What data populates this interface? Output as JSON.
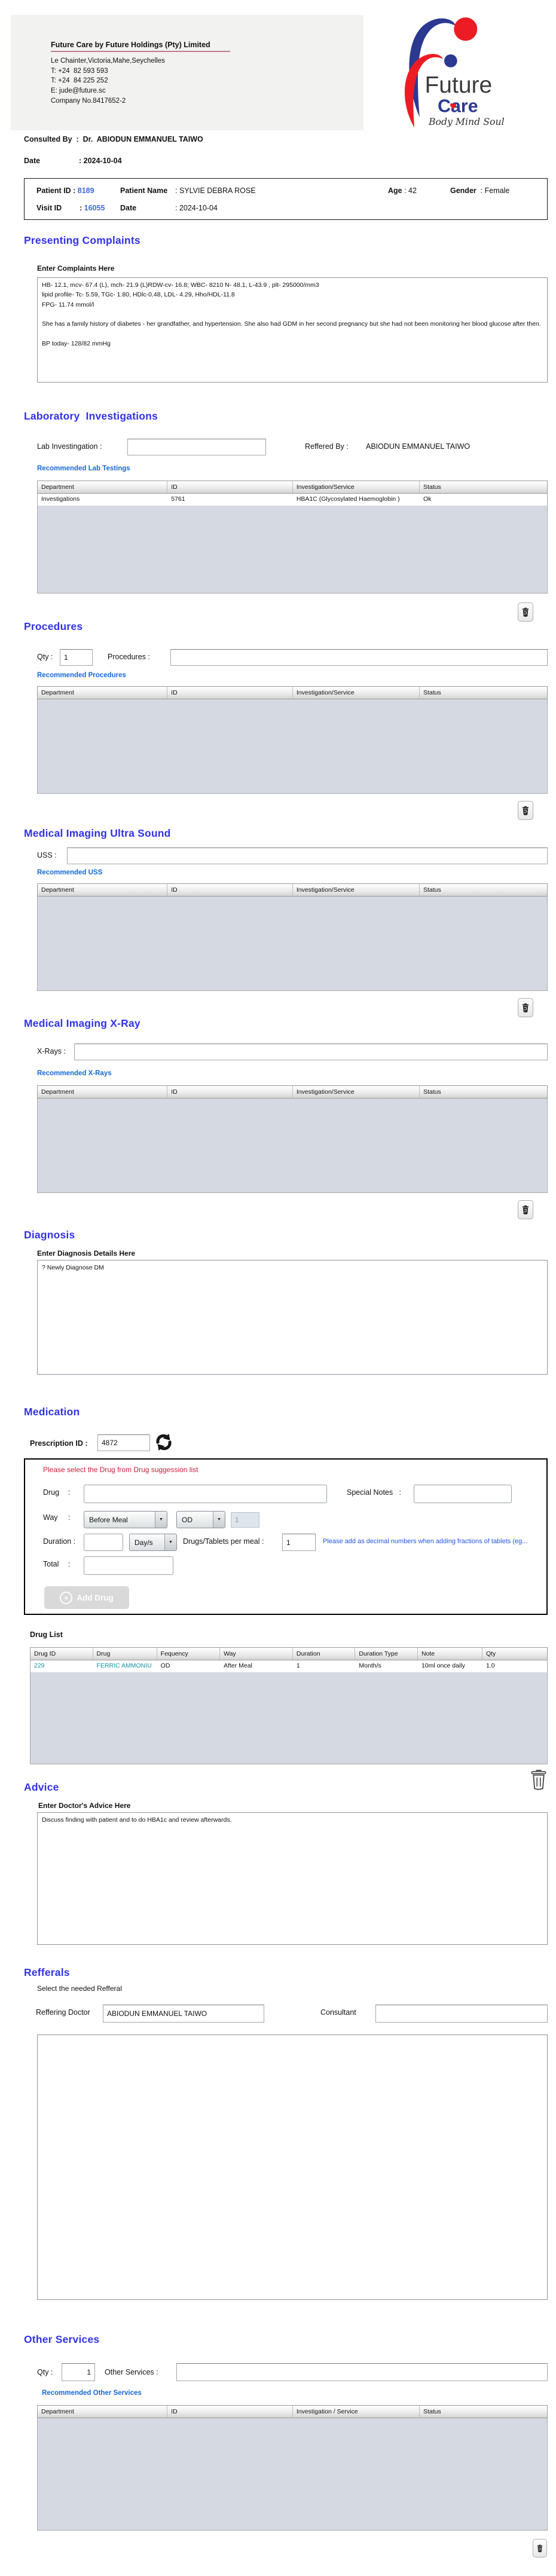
{
  "colors": {
    "heading_blue": "#3232ec",
    "link_blue": "#1569d8",
    "alert_red": "#c81e3c",
    "note_blue": "#2255e8",
    "value_blue": "#4169e1",
    "teal": "#1696a6",
    "logo_blue": "#2b3990",
    "logo_red": "#ed1c24"
  },
  "header": {
    "company_title": "Future Care by Future Holdings (Pty) Limited",
    "address": "Le Chainter,Victoria,Mahe,Seychelles",
    "phone1": "T: +24  82 593 593",
    "phone2": "T: +24  84 225 252",
    "email": "E: jude@future.sc",
    "company_no": "Company No.8417652-2",
    "logo_word1": "Future",
    "logo_word2": "Care",
    "logo_heart": "♥",
    "logo_tagline": "Body Mind Soul"
  },
  "consult": {
    "consulted_by_label": "Consulted By  :",
    "consulted_by_value": "Dr.  ABIODUN EMMANUEL TAIWO",
    "date_label": "Date",
    "date_value": ": 2024-10-04"
  },
  "patient": {
    "patient_id_label": "Patient ID :",
    "patient_id": "8189",
    "name_label": "Patient Name",
    "name_value": ": SYLVIE DEBRA ROSE",
    "age_label": "Age",
    "age_value": ": 42",
    "gender_label": "Gender",
    "gender_value": ": Female",
    "visit_id_label": "Visit ID",
    "visit_id_colon": ":",
    "visit_id": "16055",
    "visit_date_label": "Date",
    "visit_date_value": ": 2024-10-04"
  },
  "complaints": {
    "title": "Presenting Complaints",
    "enter_label": "Enter Complaints Here",
    "text": "HB- 12.1, mcv- 67.4 (L), mch- 21.9 (L)RDW-cv- 16.8; WBC- 8210 N- 48.1, L-43.9 , plt- 295000/mm3\nlipid profile- Tc- 5.59, TGc- 1.80, HDlc-0.48, LDL- 4.29, Hho/HDL-11.8\nFPG- 11.74 mmol/l\n\nShe has a family history of diabetes - her grandfather, and hypertension. She also had GDM in her second pregnancy but she had not been monitoring her blood glucose after then.\n\nBP today- 128/82 mmHg"
  },
  "lab": {
    "title": "Laboratory  Investigations",
    "input_label": "Lab Investingation :",
    "referred_label": "Reffered By :",
    "referred_value": "ABIODUN EMMANUEL TAIWO",
    "link": "Recommended Lab Testings",
    "table": {
      "headers": [
        "Department",
        "ID",
        "Investigation/Service",
        "Status"
      ],
      "rows": [
        [
          "Investigations",
          "5761",
          "HBA1C (Glycosylated Haemoglobin )",
          "Ok"
        ]
      ]
    }
  },
  "procedures": {
    "title": "Procedures",
    "qty_label": "Qty :",
    "qty_value": "1",
    "input_label": "Procedures :",
    "link": "Recommended Procedures",
    "table": {
      "headers": [
        "Department",
        "ID",
        "Investigation/Service",
        "Status"
      ],
      "rows": []
    }
  },
  "uss": {
    "title": "Medical Imaging Ultra Sound",
    "input_label": "USS :",
    "link": "Recommended USS",
    "table": {
      "headers": [
        "Department",
        "ID",
        "Investigation/Service",
        "Status"
      ],
      "rows": []
    }
  },
  "xray": {
    "title": "Medical Imaging X-Ray",
    "input_label": "X-Rays :",
    "link": "Recommended X-Rays",
    "table": {
      "headers": [
        "Department",
        "ID",
        "Investigation/Service",
        "Status"
      ],
      "rows": []
    }
  },
  "diagnosis": {
    "title": "Diagnosis",
    "enter_label": "Enter Diagnosis Details Here",
    "text": "? Newly Diagnose DM"
  },
  "medication": {
    "title": "Medication",
    "prescription_label": "Prescription ID :",
    "prescription_id": "4872",
    "hint": "Please select the Drug from Drug suggession list",
    "drug_label": "Drug",
    "colon": ":",
    "special_notes_label": "Special Notes   :",
    "way_label": "Way",
    "way_value": "Before Meal",
    "frequency_value": "OD",
    "locked_value": "1",
    "duration_label": "Duration :",
    "duration_unit_value": "Day/s",
    "per_meal_label": "Drugs/Tablets per meal :",
    "per_meal_value": "1",
    "decimal_note": "Please add as decimal numbers when adding fractions of tablets (eg...",
    "total_label": "Total",
    "add_drug_label": "Add Drug",
    "drug_list_label": "Drug List",
    "table": {
      "headers": [
        "Drug ID",
        "Drug",
        "Fequency",
        "Way",
        "Duration",
        "Duration Type",
        "Note",
        "Qty"
      ],
      "rows": [
        [
          "229",
          "FERRIC AMMONIU",
          "OD",
          "After Meal",
          "1",
          "Month/s",
          "10ml once daily",
          "1.0"
        ]
      ]
    }
  },
  "advice": {
    "title": "Advice",
    "enter_label": "Enter Doctor's Advice Here",
    "text": "Discuss finding with patient and to do HBA1c and review afterwards."
  },
  "referrals": {
    "title": "Refferals",
    "subtitle": "Select the needed Refferal",
    "doctor_label": "Reffering Doctor",
    "doctor_value": "ABIODUN EMMANUEL TAIWO",
    "consultant_label": "Consultant"
  },
  "other": {
    "title": "Other Services",
    "qty_label": "Qty :",
    "qty_value": "1",
    "input_label": "Other Services :",
    "link": "Recommended Other Services",
    "table": {
      "headers": [
        "Department",
        "ID",
        "Investigation / Service",
        "Status"
      ],
      "rows": []
    }
  }
}
